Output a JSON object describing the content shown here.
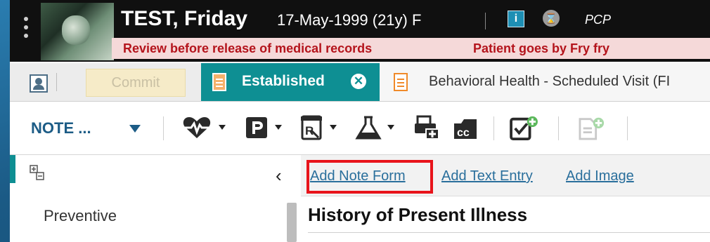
{
  "patient": {
    "name": "TEST, Friday",
    "dob_age_sex": "17-May-1999 (21y) F",
    "pcp_label": "PCP",
    "info_icon": "i",
    "alerts": [
      "Review before release of medical records",
      "Patient goes by Fry fry"
    ]
  },
  "tabs": {
    "commit_label": "Commit",
    "active": {
      "label": "Established",
      "close_icon": "close-circle-icon"
    },
    "inactive": {
      "label": "Behavioral Health - Scheduled Visit (FI"
    }
  },
  "toolbar": {
    "note_label": "NOTE ...",
    "icons": [
      "heart-pulse-icon",
      "p-icon",
      "rx-icon",
      "lab-flask-icon",
      "print-plus-icon",
      "cc-icon",
      "checklist-add-icon",
      "document-add-icon"
    ]
  },
  "left_panel": {
    "items": [
      "Preventive"
    ]
  },
  "note_actions": {
    "add_note_form": "Add Note Form",
    "add_text_entry": "Add Text Entry",
    "add_image": "Add Image"
  },
  "section": {
    "title": "History of Present Illness"
  },
  "colors": {
    "teal": "#0e8f93",
    "alert_red": "#b4141c",
    "link_blue": "#2a6f9c",
    "highlight": "#e8141b"
  }
}
